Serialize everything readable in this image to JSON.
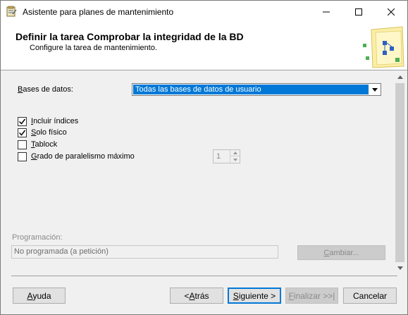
{
  "window": {
    "title": "Asistente para planes de mantenimiento"
  },
  "header": {
    "title": "Definir la tarea Comprobar la integridad de la BD",
    "subtitle": "Configure la tarea de mantenimiento."
  },
  "form": {
    "databases_label_access": "B",
    "databases_label_rest": "ases de datos:",
    "databases_value": "Todas las bases de datos de usuario",
    "options": [
      {
        "label_access": "I",
        "label_rest": "ncluir índices",
        "checked": true
      },
      {
        "label_access": "S",
        "label_rest": "olo físico",
        "checked": true
      },
      {
        "label_access": "T",
        "label_rest": "ablock",
        "checked": false
      },
      {
        "label_access": "G",
        "label_rest": "rado de paralelismo máximo",
        "checked": false
      }
    ],
    "max_dop_value": "1"
  },
  "schedule": {
    "label": "Programación:",
    "value": "No programada (a petición)",
    "change_button_access": "C",
    "change_button_rest": "ambiar..."
  },
  "footer": {
    "help_access": "A",
    "help_rest": "yuda",
    "back_prefix": "< ",
    "back_access": "A",
    "back_rest": "trás",
    "next_access": "S",
    "next_rest": "iguiente >",
    "finish_access": "F",
    "finish_rest": "inalizar >>|",
    "cancel": "Cancelar"
  },
  "colors": {
    "accent": "#0078d7",
    "window_bg": "#f0f0f0"
  },
  "icons": [
    "wizard-app-icon",
    "minimize-icon",
    "maximize-icon",
    "close-icon",
    "dropdown-arrow-icon",
    "checkmark-icon",
    "spin-up-icon",
    "spin-down-icon",
    "scroll-up-icon",
    "scroll-down-icon",
    "maintenance-folder-art"
  ]
}
